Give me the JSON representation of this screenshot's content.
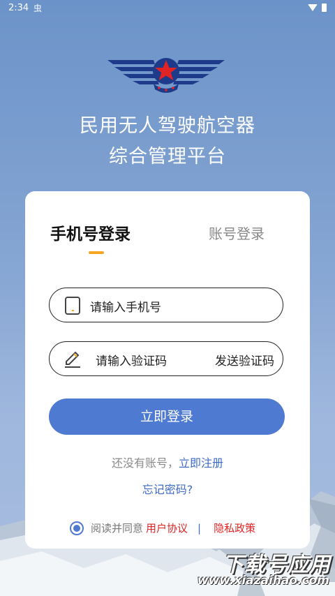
{
  "status_bar": {
    "time": "2:34",
    "notification_glyph": "虫"
  },
  "header": {
    "title_line1": "民用无人驾驶航空器",
    "title_line2": "综合管理平台"
  },
  "tabs": {
    "phone_login": "手机号登录",
    "account_login": "账号登录"
  },
  "form": {
    "phone_placeholder": "请输入手机号",
    "code_placeholder": "请输入验证码",
    "send_code": "发送验证码",
    "login_button": "立即登录"
  },
  "register": {
    "prompt": "还没有账号，",
    "link": "立即注册"
  },
  "forgot_password": "忘记密码?",
  "agreement": {
    "prefix": "阅读并同意",
    "user_agreement": "用户协议",
    "separator": "|",
    "privacy_policy": "隐私政策",
    "checked": true
  },
  "watermark": {
    "main": "下载号应用",
    "url": "www.xiazaihao.com"
  },
  "colors": {
    "primary": "#4f7ad1",
    "tab_indicator": "#f6a623",
    "link_blue": "#3d6bc7",
    "link_red": "#e02424"
  },
  "icons": [
    "wifi-icon",
    "battery-icon",
    "phone-icon",
    "pen-icon",
    "radio-checked-icon",
    "aviation-wings-logo"
  ]
}
